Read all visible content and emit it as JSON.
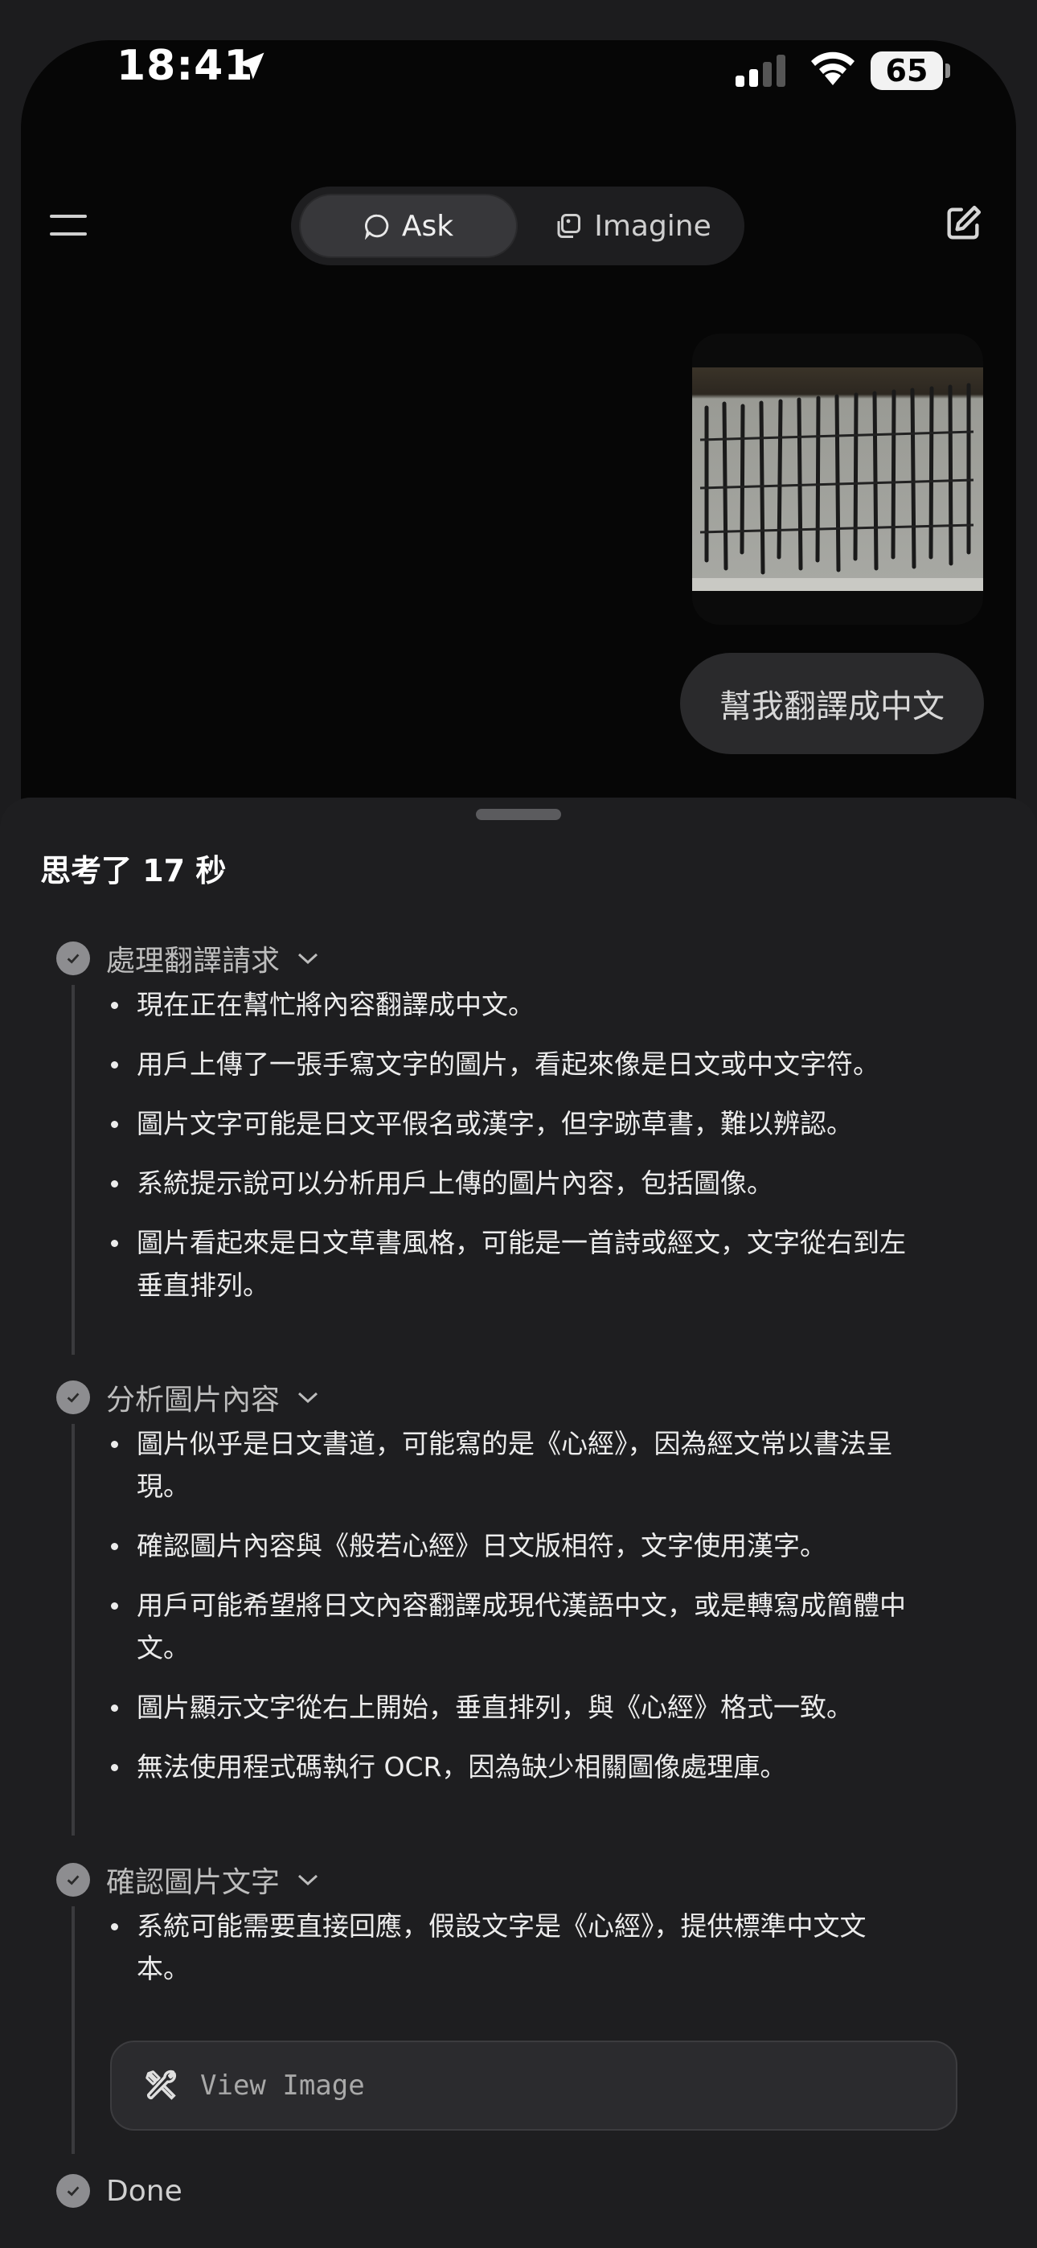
{
  "status_bar": {
    "time": "18:41",
    "battery": "65"
  },
  "header": {
    "mode_ask": "Ask",
    "mode_imagine": "Imagine"
  },
  "chat": {
    "user_message": "幫我翻譯成中文"
  },
  "sheet": {
    "title": "思考了 17 秒",
    "steps": [
      {
        "title": "處理翻譯請求",
        "bullets": [
          "現在正在幫忙將內容翻譯成中文。",
          "用戶上傳了一張手寫文字的圖片，看起來像是日文或中文字符。",
          "圖片文字可能是日文平假名或漢字，但字跡草書，難以辨認。",
          "系統提示說可以分析用戶上傳的圖片內容，包括圖像。",
          "圖片看起來是日文草書風格，可能是一首詩或經文，文字從右到左垂直排列。"
        ]
      },
      {
        "title": "分析圖片內容",
        "bullets": [
          "圖片似乎是日文書道，可能寫的是《心經》，因為經文常以書法呈現。",
          "確認圖片內容與《般若心經》日文版相符，文字使用漢字。",
          "用戶可能希望將日文內容翻譯成現代漢語中文，或是轉寫成簡體中文。",
          "圖片顯示文字從右上開始，垂直排列，與《心經》格式一致。",
          "無法使用程式碼執行 OCR，因為缺少相關圖像處理庫。"
        ]
      },
      {
        "title": "確認圖片文字",
        "bullets": [
          "系統可能需要直接回應，假設文字是《心經》，提供標準中文文本。"
        ]
      }
    ],
    "tool_call": "View Image",
    "done_label": "Done"
  }
}
